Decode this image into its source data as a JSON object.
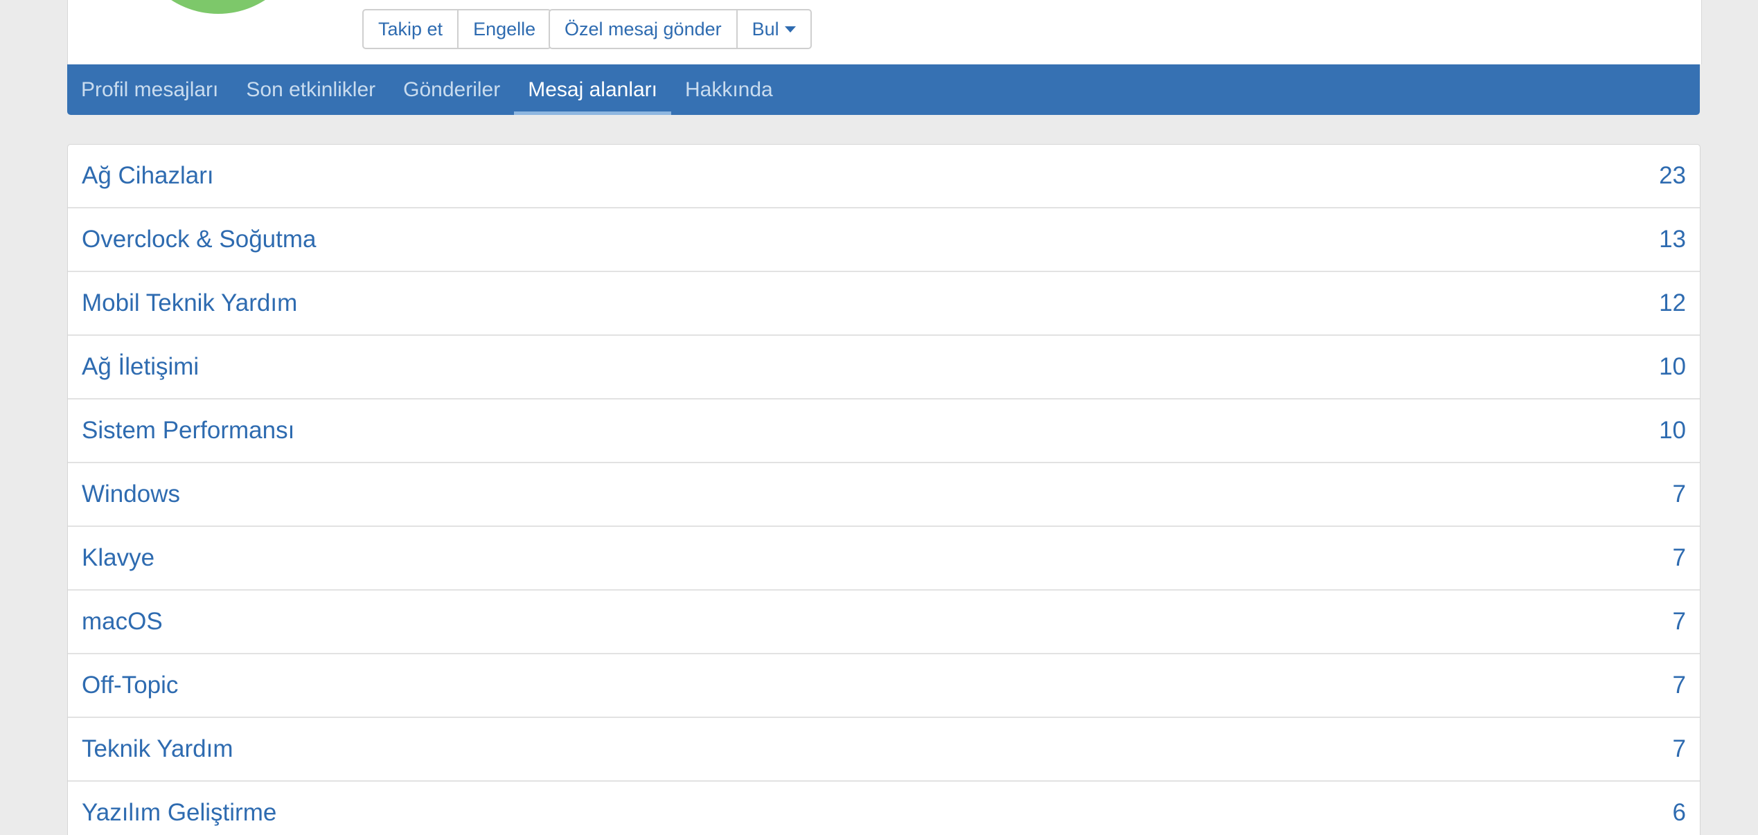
{
  "profile": {
    "buttons_group1": [
      "Takip et",
      "Engelle"
    ],
    "buttons_group2": [
      "Özel mesaj gönder"
    ],
    "find_label": "Bul"
  },
  "tabs": [
    {
      "label": "Profil mesajları",
      "active": false
    },
    {
      "label": "Son etkinlikler",
      "active": false
    },
    {
      "label": "Gönderiler",
      "active": false
    },
    {
      "label": "Mesaj alanları",
      "active": true
    },
    {
      "label": "Hakkında",
      "active": false
    }
  ],
  "forums": [
    {
      "name": "Ağ Cihazları",
      "count": "23"
    },
    {
      "name": "Overclock & Soğutma",
      "count": "13"
    },
    {
      "name": "Mobil Teknik Yardım",
      "count": "12"
    },
    {
      "name": "Ağ İletişimi",
      "count": "10"
    },
    {
      "name": "Sistem Performansı",
      "count": "10"
    },
    {
      "name": "Windows",
      "count": "7"
    },
    {
      "name": "Klavye",
      "count": "7"
    },
    {
      "name": "macOS",
      "count": "7"
    },
    {
      "name": "Off-Topic",
      "count": "7"
    },
    {
      "name": "Teknik Yardım",
      "count": "7"
    },
    {
      "name": "Yazılım Geliştirme",
      "count": "6"
    }
  ],
  "colors": {
    "accent": "#3671b3",
    "link": "#2e6bb0",
    "avatar": "#7dc86a"
  }
}
